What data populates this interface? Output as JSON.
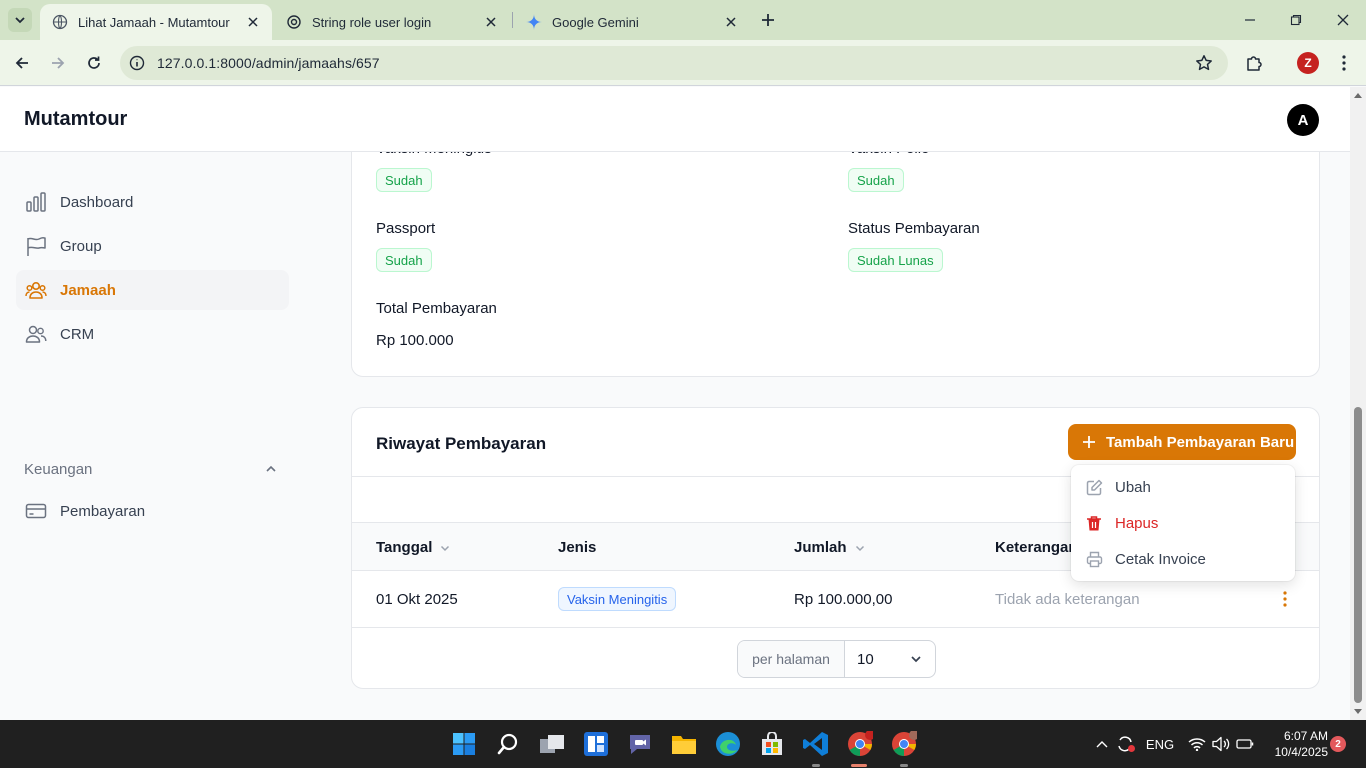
{
  "browser": {
    "tabs": [
      {
        "title": "Lihat Jamaah - Mutamtour",
        "active": true
      },
      {
        "title": "String role user login",
        "active": false
      },
      {
        "title": "Google Gemini",
        "active": false
      }
    ],
    "url": "127.0.0.1:8000/admin/jamaahs/657",
    "profile_initial": "Z"
  },
  "app": {
    "brand": "Mutamtour",
    "user_initial": "A",
    "accent_color": "#d97706"
  },
  "sidebar": {
    "items": [
      {
        "label": "Dashboard",
        "icon": "chart-bar-icon"
      },
      {
        "label": "Group",
        "icon": "flag-icon"
      },
      {
        "label": "Jamaah",
        "icon": "user-group-icon",
        "active": true
      },
      {
        "label": "CRM",
        "icon": "users-icon"
      }
    ],
    "groups": [
      {
        "label": "Keuangan",
        "items": [
          {
            "label": "Pembayaran",
            "icon": "credit-card-icon"
          }
        ]
      }
    ]
  },
  "details": {
    "vaksin_meningitis": {
      "label": "Vaksin Meningitis",
      "value": "Sudah"
    },
    "vaksin_polio": {
      "label": "Vaksin Polio",
      "value": "Sudah"
    },
    "passport": {
      "label": "Passport",
      "value": "Sudah"
    },
    "status_pembayaran": {
      "label": "Status Pembayaran",
      "value": "Sudah Lunas"
    },
    "total_pembayaran": {
      "label": "Total Pembayaran",
      "value": "Rp 100.000"
    }
  },
  "payments": {
    "title": "Riwayat Pembayaran",
    "add_button": "Tambah Pembayaran Baru",
    "columns": [
      "Tanggal",
      "Jenis",
      "Jumlah",
      "Keterangan"
    ],
    "rows": [
      {
        "tanggal": "01 Okt 2025",
        "jenis": "Vaksin Meningitis",
        "jumlah": "Rp 100.000,00",
        "keterangan": "Tidak ada keterangan"
      }
    ],
    "per_page_label": "per halaman",
    "per_page_value": "10"
  },
  "row_menu": {
    "items": [
      {
        "label": "Ubah",
        "icon": "pencil-square-icon"
      },
      {
        "label": "Hapus",
        "icon": "trash-icon"
      },
      {
        "label": "Cetak Invoice",
        "icon": "printer-icon"
      }
    ]
  },
  "taskbar": {
    "language": "ENG",
    "time": "6:07 AM",
    "date": "10/4/2025",
    "notifications": "2",
    "chrome_badge": "Z"
  }
}
